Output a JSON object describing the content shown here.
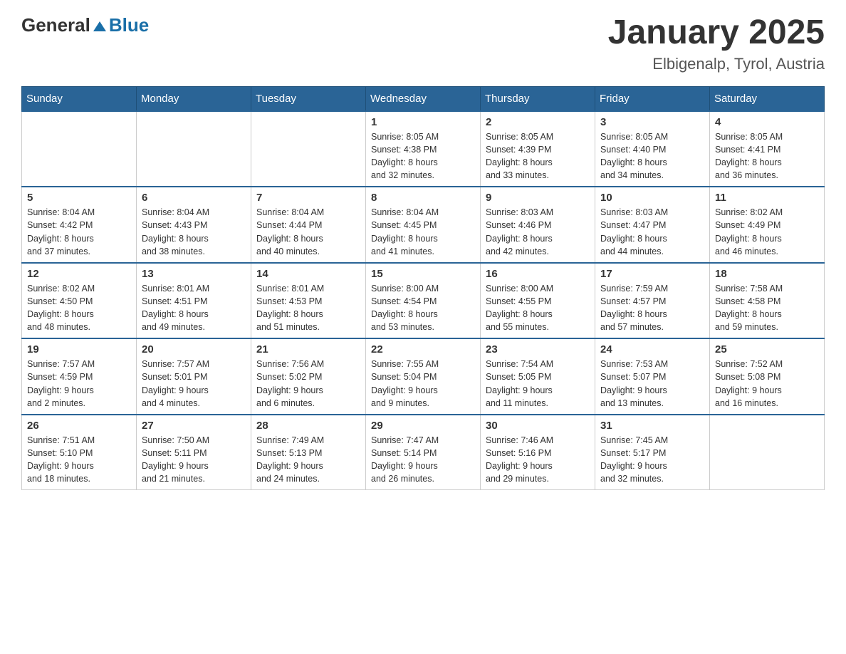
{
  "logo": {
    "general": "General",
    "blue": "Blue"
  },
  "header": {
    "title": "January 2025",
    "subtitle": "Elbigenalp, Tyrol, Austria"
  },
  "weekdays": [
    "Sunday",
    "Monday",
    "Tuesday",
    "Wednesday",
    "Thursday",
    "Friday",
    "Saturday"
  ],
  "weeks": [
    [
      {
        "day": "",
        "info": ""
      },
      {
        "day": "",
        "info": ""
      },
      {
        "day": "",
        "info": ""
      },
      {
        "day": "1",
        "info": "Sunrise: 8:05 AM\nSunset: 4:38 PM\nDaylight: 8 hours\nand 32 minutes."
      },
      {
        "day": "2",
        "info": "Sunrise: 8:05 AM\nSunset: 4:39 PM\nDaylight: 8 hours\nand 33 minutes."
      },
      {
        "day": "3",
        "info": "Sunrise: 8:05 AM\nSunset: 4:40 PM\nDaylight: 8 hours\nand 34 minutes."
      },
      {
        "day": "4",
        "info": "Sunrise: 8:05 AM\nSunset: 4:41 PM\nDaylight: 8 hours\nand 36 minutes."
      }
    ],
    [
      {
        "day": "5",
        "info": "Sunrise: 8:04 AM\nSunset: 4:42 PM\nDaylight: 8 hours\nand 37 minutes."
      },
      {
        "day": "6",
        "info": "Sunrise: 8:04 AM\nSunset: 4:43 PM\nDaylight: 8 hours\nand 38 minutes."
      },
      {
        "day": "7",
        "info": "Sunrise: 8:04 AM\nSunset: 4:44 PM\nDaylight: 8 hours\nand 40 minutes."
      },
      {
        "day": "8",
        "info": "Sunrise: 8:04 AM\nSunset: 4:45 PM\nDaylight: 8 hours\nand 41 minutes."
      },
      {
        "day": "9",
        "info": "Sunrise: 8:03 AM\nSunset: 4:46 PM\nDaylight: 8 hours\nand 42 minutes."
      },
      {
        "day": "10",
        "info": "Sunrise: 8:03 AM\nSunset: 4:47 PM\nDaylight: 8 hours\nand 44 minutes."
      },
      {
        "day": "11",
        "info": "Sunrise: 8:02 AM\nSunset: 4:49 PM\nDaylight: 8 hours\nand 46 minutes."
      }
    ],
    [
      {
        "day": "12",
        "info": "Sunrise: 8:02 AM\nSunset: 4:50 PM\nDaylight: 8 hours\nand 48 minutes."
      },
      {
        "day": "13",
        "info": "Sunrise: 8:01 AM\nSunset: 4:51 PM\nDaylight: 8 hours\nand 49 minutes."
      },
      {
        "day": "14",
        "info": "Sunrise: 8:01 AM\nSunset: 4:53 PM\nDaylight: 8 hours\nand 51 minutes."
      },
      {
        "day": "15",
        "info": "Sunrise: 8:00 AM\nSunset: 4:54 PM\nDaylight: 8 hours\nand 53 minutes."
      },
      {
        "day": "16",
        "info": "Sunrise: 8:00 AM\nSunset: 4:55 PM\nDaylight: 8 hours\nand 55 minutes."
      },
      {
        "day": "17",
        "info": "Sunrise: 7:59 AM\nSunset: 4:57 PM\nDaylight: 8 hours\nand 57 minutes."
      },
      {
        "day": "18",
        "info": "Sunrise: 7:58 AM\nSunset: 4:58 PM\nDaylight: 8 hours\nand 59 minutes."
      }
    ],
    [
      {
        "day": "19",
        "info": "Sunrise: 7:57 AM\nSunset: 4:59 PM\nDaylight: 9 hours\nand 2 minutes."
      },
      {
        "day": "20",
        "info": "Sunrise: 7:57 AM\nSunset: 5:01 PM\nDaylight: 9 hours\nand 4 minutes."
      },
      {
        "day": "21",
        "info": "Sunrise: 7:56 AM\nSunset: 5:02 PM\nDaylight: 9 hours\nand 6 minutes."
      },
      {
        "day": "22",
        "info": "Sunrise: 7:55 AM\nSunset: 5:04 PM\nDaylight: 9 hours\nand 9 minutes."
      },
      {
        "day": "23",
        "info": "Sunrise: 7:54 AM\nSunset: 5:05 PM\nDaylight: 9 hours\nand 11 minutes."
      },
      {
        "day": "24",
        "info": "Sunrise: 7:53 AM\nSunset: 5:07 PM\nDaylight: 9 hours\nand 13 minutes."
      },
      {
        "day": "25",
        "info": "Sunrise: 7:52 AM\nSunset: 5:08 PM\nDaylight: 9 hours\nand 16 minutes."
      }
    ],
    [
      {
        "day": "26",
        "info": "Sunrise: 7:51 AM\nSunset: 5:10 PM\nDaylight: 9 hours\nand 18 minutes."
      },
      {
        "day": "27",
        "info": "Sunrise: 7:50 AM\nSunset: 5:11 PM\nDaylight: 9 hours\nand 21 minutes."
      },
      {
        "day": "28",
        "info": "Sunrise: 7:49 AM\nSunset: 5:13 PM\nDaylight: 9 hours\nand 24 minutes."
      },
      {
        "day": "29",
        "info": "Sunrise: 7:47 AM\nSunset: 5:14 PM\nDaylight: 9 hours\nand 26 minutes."
      },
      {
        "day": "30",
        "info": "Sunrise: 7:46 AM\nSunset: 5:16 PM\nDaylight: 9 hours\nand 29 minutes."
      },
      {
        "day": "31",
        "info": "Sunrise: 7:45 AM\nSunset: 5:17 PM\nDaylight: 9 hours\nand 32 minutes."
      },
      {
        "day": "",
        "info": ""
      }
    ]
  ]
}
